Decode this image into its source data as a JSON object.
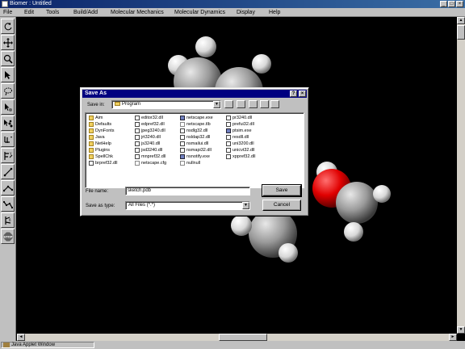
{
  "window": {
    "title": "Biomer : Untitled",
    "min": "_",
    "max": "□",
    "close": "×"
  },
  "menu": [
    "File",
    "Edit",
    "Tools",
    "Build/Add",
    "Molecular Mechanics",
    "Molecular Dynamics",
    "Display",
    "Help"
  ],
  "toolbar_icons": [
    "rotate-icon",
    "translate-icon",
    "zoom-icon",
    "select-arrow-icon",
    "lasso-icon",
    "atom-add-icon",
    "group-add-icon",
    "bond-tool-icon",
    "ring-tool-icon",
    "measure-distance-icon",
    "measure-angle-icon",
    "torsion-icon",
    "charge-icon",
    "stop-icon"
  ],
  "dialog": {
    "title": "Save As",
    "help": "?",
    "close": "×",
    "save_in_label": "Save in:",
    "save_in_value": "Program",
    "file_name_label": "File name:",
    "file_name_value": "sketch.pdb",
    "save_as_type_label": "Save as type:",
    "save_as_type_value": "All Files (*.*)",
    "save_button": "Save",
    "cancel_button": "Cancel",
    "files": [
      [
        {
          "name": "Aim",
          "type": "folder"
        },
        {
          "name": "Defaults",
          "type": "folder"
        },
        {
          "name": "DynFonts",
          "type": "folder"
        },
        {
          "name": "Java",
          "type": "folder"
        },
        {
          "name": "NetHelp",
          "type": "folder"
        },
        {
          "name": "Plugins",
          "type": "folder"
        },
        {
          "name": "SpellChk",
          "type": "folder"
        },
        {
          "name": "brpref32.dll",
          "type": "dll"
        }
      ],
      [
        {
          "name": "editor32.dll",
          "type": "dll"
        },
        {
          "name": "edpref32.dll",
          "type": "dll"
        },
        {
          "name": "jpeg3240.dll",
          "type": "dll"
        },
        {
          "name": "jrt3240.dll",
          "type": "dll"
        },
        {
          "name": "js3240.dll",
          "type": "dll"
        },
        {
          "name": "jsd3240.dll",
          "type": "dll"
        },
        {
          "name": "mnpref32.dll",
          "type": "dll"
        },
        {
          "name": "netscape.cfg",
          "type": "doc"
        }
      ],
      [
        {
          "name": "netscape.exe",
          "type": "exe"
        },
        {
          "name": "netscape.tlb",
          "type": "doc"
        },
        {
          "name": "nsdlg32.dll",
          "type": "dll"
        },
        {
          "name": "nsldap32.dll",
          "type": "dll"
        },
        {
          "name": "nsmailui.dll",
          "type": "dll"
        },
        {
          "name": "nsmapi32.dll",
          "type": "dll"
        },
        {
          "name": "nsnotify.exe",
          "type": "exe"
        },
        {
          "name": "nullnull",
          "type": "doc"
        }
      ],
      [
        {
          "name": "pr3240.dll",
          "type": "dll"
        },
        {
          "name": "prefui32.dll",
          "type": "dll"
        },
        {
          "name": "ptsim.exe",
          "type": "exe"
        },
        {
          "name": "resdll.dll",
          "type": "dll"
        },
        {
          "name": "uni3200.dll",
          "type": "dll"
        },
        {
          "name": "unicvt32.dll",
          "type": "dll"
        },
        {
          "name": "xppref32.dll",
          "type": "dll"
        }
      ]
    ]
  },
  "status": {
    "applet": "Java Applet Window"
  },
  "colors": {
    "carbon": "#a8a8a8",
    "hydrogen": "#ffffff",
    "oxygen": "#ff0000",
    "titlebar": "#000080"
  }
}
